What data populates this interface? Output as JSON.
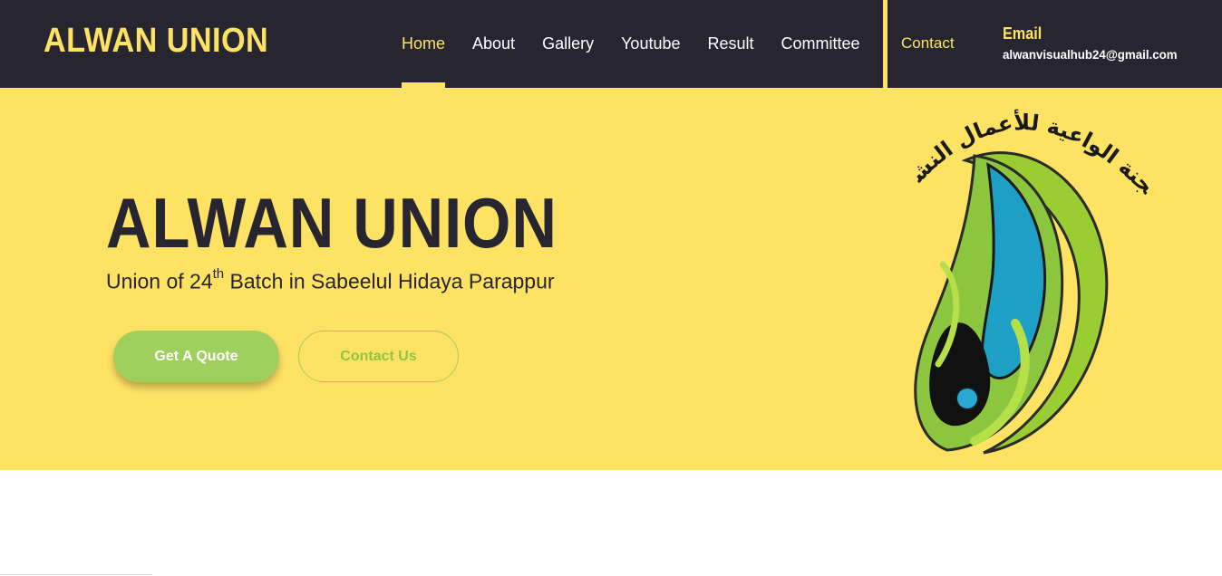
{
  "brand": "ALWAN UNION",
  "nav": {
    "items": [
      {
        "label": "Home",
        "active": true
      },
      {
        "label": "About"
      },
      {
        "label": "Gallery"
      },
      {
        "label": "Youtube"
      },
      {
        "label": "Result"
      },
      {
        "label": "Committee"
      }
    ],
    "contact": "Contact"
  },
  "email": {
    "label": "Email",
    "value": "alwanvisualhub24@gmail.com"
  },
  "hero": {
    "title": "ALWAN UNION",
    "subtitle_pre": "Union of 24",
    "subtitle_sup": "th",
    "subtitle_post": " Batch in Sabeelul Hidaya Parappur",
    "btn_quote": "Get A Quote",
    "btn_contact": "Contact Us",
    "logo_text": "اللجنة الواعية للأعمال النشطة"
  },
  "colors": {
    "dark": "#272630",
    "accent": "#fde264",
    "green": "#9fd05e"
  }
}
